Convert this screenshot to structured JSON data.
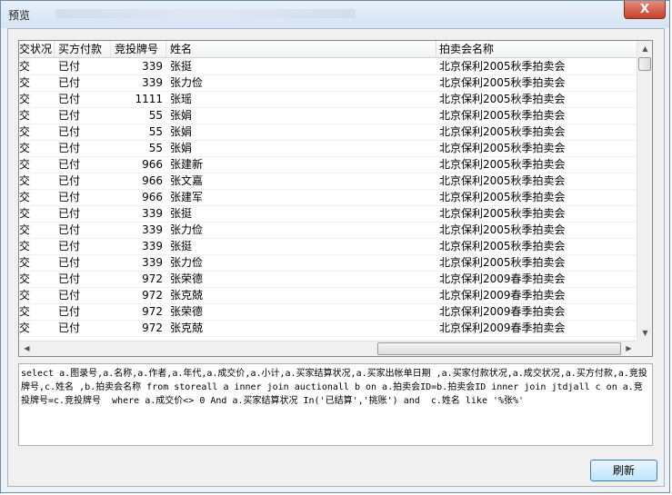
{
  "window": {
    "title": "预览",
    "close_label": "X"
  },
  "grid": {
    "columns": [
      "交状况",
      "买方付款",
      "竞投牌号",
      "姓名",
      "拍卖会名称"
    ],
    "rows": [
      [
        "交",
        "已付",
        "339",
        "张挺",
        "北京保利2005秋季拍卖会"
      ],
      [
        "交",
        "已付",
        "339",
        "张力俭",
        "北京保利2005秋季拍卖会"
      ],
      [
        "交",
        "已付",
        "1111",
        "张瑶",
        "北京保利2005秋季拍卖会"
      ],
      [
        "交",
        "已付",
        "55",
        "张娟",
        "北京保利2005秋季拍卖会"
      ],
      [
        "交",
        "已付",
        "55",
        "张娟",
        "北京保利2005秋季拍卖会"
      ],
      [
        "交",
        "已付",
        "55",
        "张娟",
        "北京保利2005秋季拍卖会"
      ],
      [
        "交",
        "已付",
        "966",
        "张建新",
        "北京保利2005秋季拍卖会"
      ],
      [
        "交",
        "已付",
        "966",
        "张文嘉",
        "北京保利2005秋季拍卖会"
      ],
      [
        "交",
        "已付",
        "966",
        "张建军",
        "北京保利2005秋季拍卖会"
      ],
      [
        "交",
        "已付",
        "339",
        "张挺",
        "北京保利2005秋季拍卖会"
      ],
      [
        "交",
        "已付",
        "339",
        "张力俭",
        "北京保利2005秋季拍卖会"
      ],
      [
        "交",
        "已付",
        "339",
        "张挺",
        "北京保利2005秋季拍卖会"
      ],
      [
        "交",
        "已付",
        "339",
        "张力俭",
        "北京保利2005秋季拍卖会"
      ],
      [
        "交",
        "已付",
        "972",
        "张荣德",
        "北京保利2009春季拍卖会"
      ],
      [
        "交",
        "已付",
        "972",
        "张克兢",
        "北京保利2009春季拍卖会"
      ],
      [
        "交",
        "已付",
        "972",
        "张荣德",
        "北京保利2009春季拍卖会"
      ],
      [
        "交",
        "已付",
        "972",
        "张克兢",
        "北京保利2009春季拍卖会"
      ]
    ]
  },
  "sql_text": "select a.图录号,a.名称,a.作者,a.年代,a.成交价,a.小计,a.买家结算状况,a.买家出帐单日期 ,a.买家付款状况,a.成交状况,a.买方付款,a.竞投牌号,c.姓名 ,b.拍卖会名称 from storeall a inner join auctionall b on a.拍卖会ID=b.拍卖会ID inner join jtdjall c on a.竞投牌号=c.竞投牌号  where a.成交价<> 0 And a.买家结算状况 In('已结算','挑账') and  c.姓名 like '%张%'",
  "buttons": {
    "refresh": "刷新"
  },
  "icons": {
    "scroll_up": "up-arrow",
    "scroll_down": "down-arrow",
    "scroll_left": "left-arrow",
    "scroll_right": "right-arrow"
  }
}
